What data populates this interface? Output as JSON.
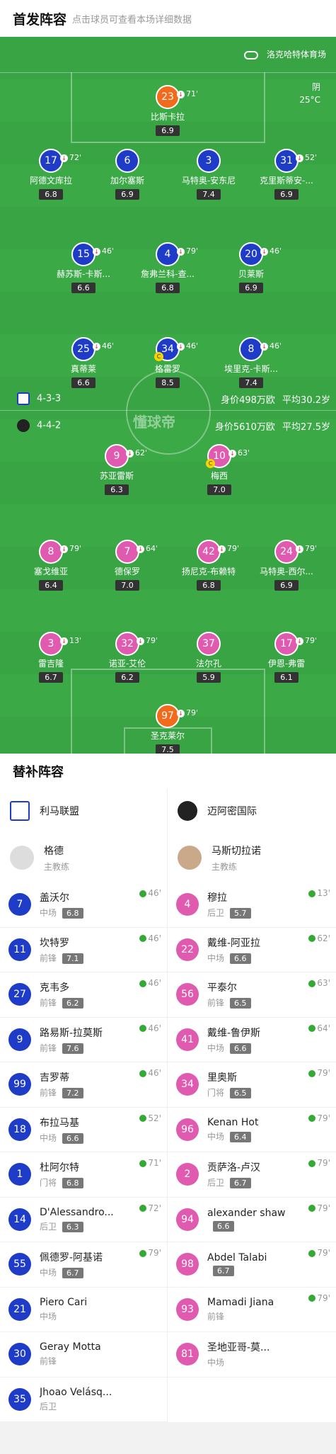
{
  "header": {
    "title": "首发阵容",
    "subtitle": "点击球员可查看本场详细数据"
  },
  "venue": "洛克哈特体育场",
  "weather": {
    "condition": "阴",
    "temp": "25°C"
  },
  "home_formation": {
    "formation": "4-3-3",
    "value": "身价498万欧",
    "age": "平均30.2岁"
  },
  "away_formation": {
    "formation": "4-4-2",
    "value": "身价5610万欧",
    "age": "平均27.5岁"
  },
  "watermark": "懂球帝",
  "colors": {
    "home": "#1e3cc8",
    "away": "#e05bb0",
    "gk": "#f26a1b"
  },
  "home_players": [
    {
      "num": "23",
      "name": "比斯卡拉",
      "rating": "6.9",
      "sub": "71'",
      "kind": "gk"
    },
    {
      "num": "17",
      "name": "阿德文库拉",
      "rating": "6.8",
      "sub": "72'"
    },
    {
      "num": "6",
      "name": "加尔塞斯",
      "rating": "6.9",
      "sub": ""
    },
    {
      "num": "3",
      "name": "马特奥-安东尼",
      "rating": "7.4",
      "sub": ""
    },
    {
      "num": "31",
      "name": "克里斯蒂安-...",
      "rating": "6.9",
      "sub": "52'"
    },
    {
      "num": "15",
      "name": "赫苏斯-卡斯...",
      "rating": "6.6",
      "sub": "46'"
    },
    {
      "num": "4",
      "name": "詹弗兰科-查...",
      "rating": "6.8",
      "sub": "79'"
    },
    {
      "num": "20",
      "name": "贝莱斯",
      "rating": "6.9",
      "sub": "46'"
    },
    {
      "num": "25",
      "name": "真蒂莱",
      "rating": "6.6",
      "sub": "46'"
    },
    {
      "num": "34",
      "name": "格雷罗",
      "rating": "8.5",
      "sub": "46'",
      "captain": true
    },
    {
      "num": "8",
      "name": "埃里克-卡斯...",
      "rating": "7.4",
      "sub": "46'"
    }
  ],
  "away_players": [
    {
      "num": "9",
      "name": "苏亚雷斯",
      "rating": "6.3",
      "sub": "62'"
    },
    {
      "num": "10",
      "name": "梅西",
      "rating": "7.0",
      "sub": "63'",
      "captain": true
    },
    {
      "num": "8",
      "name": "塞戈维亚",
      "rating": "6.4",
      "sub": "79'"
    },
    {
      "num": "7",
      "name": "德保罗",
      "rating": "7.0",
      "sub": "64'"
    },
    {
      "num": "42",
      "name": "扬尼克-布赖特",
      "rating": "6.8",
      "sub": "79'"
    },
    {
      "num": "24",
      "name": "马特奥-西尔...",
      "rating": "6.9",
      "sub": "79'"
    },
    {
      "num": "3",
      "name": "雷吉隆",
      "rating": "6.7",
      "sub": "13'"
    },
    {
      "num": "32",
      "name": "诺亚-艾伦",
      "rating": "6.2",
      "sub": "79'"
    },
    {
      "num": "37",
      "name": "法尔孔",
      "rating": "5.9",
      "sub": ""
    },
    {
      "num": "17",
      "name": "伊恩-弗雷",
      "rating": "6.1",
      "sub": "79'"
    },
    {
      "num": "97",
      "name": "圣克莱尔",
      "rating": "7.5",
      "sub": "79'",
      "kind": "gk"
    }
  ],
  "subs_title": "替补阵容",
  "home_team": {
    "name": "利马联盟",
    "coach": "格德",
    "coach_role": "主教练"
  },
  "away_team": {
    "name": "迈阿密国际",
    "coach": "马斯切拉诺",
    "coach_role": "主教练"
  },
  "home_subs": [
    {
      "num": "7",
      "name": "盖沃尔",
      "pos": "中场",
      "rating": "6.8",
      "time": "46'"
    },
    {
      "num": "11",
      "name": "坎特罗",
      "pos": "前锋",
      "rating": "7.1",
      "time": "46'"
    },
    {
      "num": "27",
      "name": "克韦多",
      "pos": "前锋",
      "rating": "6.2",
      "time": "46'"
    },
    {
      "num": "9",
      "name": "路易斯-拉莫斯",
      "pos": "前锋",
      "rating": "7.6",
      "time": "46'"
    },
    {
      "num": "99",
      "name": "吉罗蒂",
      "pos": "前锋",
      "rating": "7.2",
      "time": "46'"
    },
    {
      "num": "18",
      "name": "布拉马基",
      "pos": "中场",
      "rating": "6.6",
      "time": "52'"
    },
    {
      "num": "1",
      "name": "杜阿尔特",
      "pos": "门将",
      "rating": "6.8",
      "time": "71'"
    },
    {
      "num": "14",
      "name": "D'Alessandro...",
      "pos": "后卫",
      "rating": "6.3",
      "time": "72'"
    },
    {
      "num": "55",
      "name": "佩德罗-阿基诺",
      "pos": "中场",
      "rating": "6.7",
      "time": "79'"
    },
    {
      "num": "21",
      "name": "Piero Cari",
      "pos": "中场",
      "rating": "",
      "time": ""
    },
    {
      "num": "30",
      "name": "Geray Motta",
      "pos": "前锋",
      "rating": "",
      "time": ""
    },
    {
      "num": "35",
      "name": "Jhoao Velásq...",
      "pos": "后卫",
      "rating": "",
      "time": ""
    }
  ],
  "away_subs": [
    {
      "num": "4",
      "name": "穆拉",
      "pos": "后卫",
      "rating": "5.7",
      "time": "13'"
    },
    {
      "num": "22",
      "name": "戴维-阿亚拉",
      "pos": "中场",
      "rating": "6.6",
      "time": "62'"
    },
    {
      "num": "56",
      "name": "平泰尔",
      "pos": "前锋",
      "rating": "6.5",
      "time": "63'"
    },
    {
      "num": "41",
      "name": "戴维-鲁伊斯",
      "pos": "中场",
      "rating": "6.6",
      "time": "64'"
    },
    {
      "num": "34",
      "name": "里奥斯",
      "pos": "门将",
      "rating": "6.5",
      "time": "79'"
    },
    {
      "num": "96",
      "name": "Kenan Hot",
      "pos": "中场",
      "rating": "6.4",
      "time": "79'"
    },
    {
      "num": "2",
      "name": "贡萨洛-卢汉",
      "pos": "后卫",
      "rating": "6.7",
      "time": "79'"
    },
    {
      "num": "94",
      "name": "alexander shaw",
      "pos": "",
      "rating": "6.6",
      "time": "79'"
    },
    {
      "num": "98",
      "name": "Abdel Talabi",
      "pos": "",
      "rating": "6.7",
      "time": "79'"
    },
    {
      "num": "93",
      "name": "Mamadi Jiana",
      "pos": "前锋",
      "rating": "",
      "time": "79'"
    },
    {
      "num": "81",
      "name": "圣地亚哥-莫...",
      "pos": "中场",
      "rating": "",
      "time": ""
    }
  ]
}
